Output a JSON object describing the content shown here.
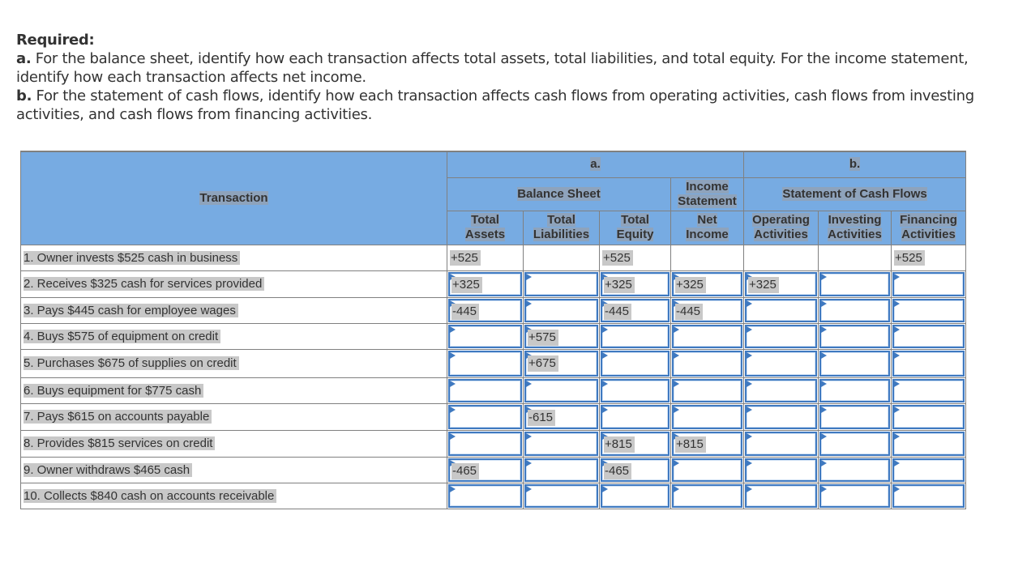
{
  "instructions": {
    "required_label": "Required:",
    "part_a_label": "a.",
    "part_a_text": " For the balance sheet, identify how each transaction affects total assets, total liabilities, and total equity. For the income statement, identify how each transaction affects net income.",
    "part_b_label": "b.",
    "part_b_text": " For the statement of cash flows, identify how each transaction affects cash flows from operating activities, cash flows from investing activities, and cash flows from financing activities."
  },
  "table": {
    "transaction_header": "Transaction",
    "group_a": "a.",
    "group_b": "b.",
    "balance_sheet": "Balance Sheet",
    "income_statement_line1": "Income",
    "income_statement_line2": "Statement",
    "cash_flows": "Statement of Cash Flows",
    "columns": [
      {
        "line1": "Total",
        "line2": "Assets"
      },
      {
        "line1": "Total",
        "line2": "Liabilities"
      },
      {
        "line1": "Total",
        "line2": "Equity"
      },
      {
        "line1": "Net",
        "line2": "Income"
      },
      {
        "line1": "Operating",
        "line2": "Activities"
      },
      {
        "line1": "Investing",
        "line2": "Activities"
      },
      {
        "line1": "Financing",
        "line2": "Activities"
      }
    ],
    "rows": [
      {
        "transaction": "1. Owner invests $525 cash in business",
        "editable": false,
        "values": [
          "+525",
          "",
          "+525",
          "",
          "",
          "",
          "+525"
        ]
      },
      {
        "transaction": "2. Receives $325 cash for services provided",
        "editable": true,
        "values": [
          "+325",
          "",
          "+325",
          "+325",
          "+325",
          "",
          ""
        ]
      },
      {
        "transaction": "3. Pays $445 cash for employee wages",
        "editable": true,
        "values": [
          "-445",
          "",
          "-445",
          "-445",
          "",
          "",
          ""
        ]
      },
      {
        "transaction": "4. Buys $575 of equipment on credit",
        "editable": true,
        "values": [
          "",
          "+575",
          "",
          "",
          "",
          "",
          ""
        ]
      },
      {
        "transaction": "5. Purchases $675 of supplies on credit",
        "editable": true,
        "values": [
          "",
          "+675",
          "",
          "",
          "",
          "",
          ""
        ]
      },
      {
        "transaction": "6. Buys equipment for $775 cash",
        "editable": true,
        "values": [
          "",
          "",
          "",
          "",
          "",
          "",
          ""
        ]
      },
      {
        "transaction": "7. Pays $615 on accounts payable",
        "editable": true,
        "values": [
          "",
          "-615",
          "",
          "",
          "",
          "",
          ""
        ]
      },
      {
        "transaction": "8. Provides $815 services on credit",
        "editable": true,
        "values": [
          "",
          "",
          "+815",
          "+815",
          "",
          "",
          ""
        ]
      },
      {
        "transaction": "9. Owner withdraws $465 cash",
        "editable": true,
        "values": [
          "-465",
          "",
          "-465",
          "",
          "",
          "",
          ""
        ]
      },
      {
        "transaction": "10. Collects $840 cash on accounts receivable",
        "editable": true,
        "values": [
          "",
          "",
          "",
          "",
          "",
          "",
          ""
        ]
      }
    ]
  },
  "colors": {
    "header_bg": "#77abe2",
    "input_border": "#3f79c0",
    "answer_highlight": "#c8c8c8"
  }
}
